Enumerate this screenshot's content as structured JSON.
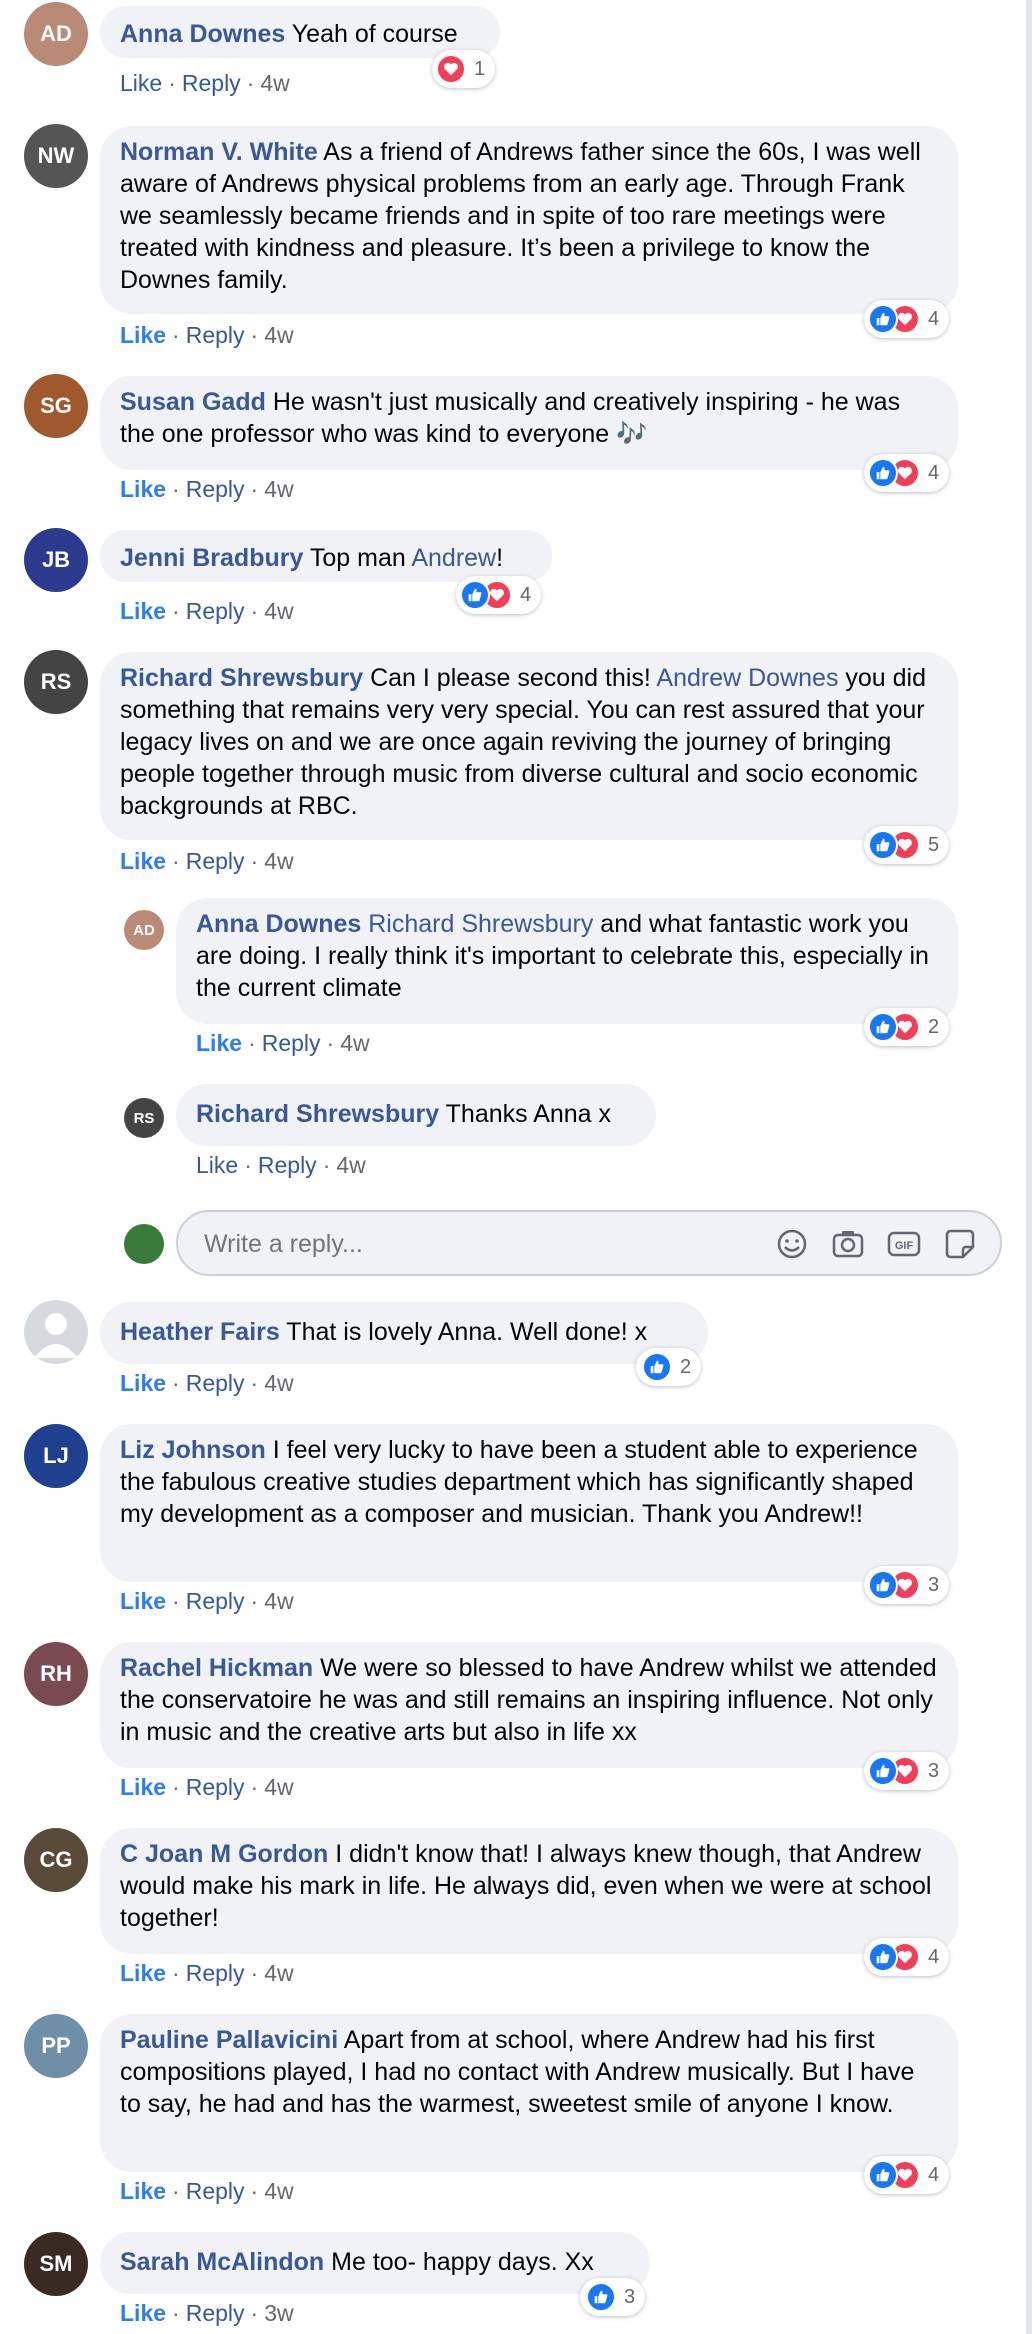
{
  "reactions": {
    "like_color": "#1877f2",
    "love_color": "#f33e58"
  },
  "comments": [
    {
      "author": "Anna Downes",
      "text": "Yeah of course",
      "like": "Like",
      "reply": "Reply",
      "time": "4w",
      "count": "1"
    },
    {
      "author": "Norman V. White",
      "text": "As a friend of Andrews father since the 60s, I was well aware of Andrews physical problems from an early age. Through Frank we seamlessly became friends and in spite of too rare meetings were treated with kindness and pleasure. It’s been a privilege to know the Downes family.",
      "like": "Like",
      "reply": "Reply",
      "time": "4w",
      "count": "4"
    },
    {
      "author": "Susan Gadd",
      "text": "He wasn't just musically and creatively inspiring - he was the one professor who was kind to everyone 🎶",
      "like": "Like",
      "reply": "Reply",
      "time": "4w",
      "count": "4"
    },
    {
      "author": "Jenni Bradbury",
      "text_before": "Top man",
      "mention": "Andrew",
      "text_after": "!",
      "like": "Like",
      "reply": "Reply",
      "time": "4w",
      "count": "4"
    },
    {
      "author": "Richard Shrewsbury",
      "text_before": "Can I please second this!",
      "mention": "Andrew Downes",
      "text_after": "you did something that remains very very special. You can rest assured that your legacy lives on and we are once again reviving the journey of bringing people together through music from diverse cultural and socio economic backgrounds at RBC.",
      "like": "Like",
      "reply": "Reply",
      "time": "4w",
      "count": "5"
    },
    {
      "author": "Anna Downes",
      "mention": "Richard Shrewsbury",
      "text_after": "and what fantastic work you are doing. I really think it's important to celebrate this, especially in the current climate",
      "like": "Like",
      "reply": "Reply",
      "time": "4w",
      "count": "2"
    },
    {
      "author": "Richard Shrewsbury",
      "text": "Thanks Anna x",
      "like": "Like",
      "reply": "Reply",
      "time": "4w"
    },
    {
      "author": "Heather Fairs",
      "text": "That is lovely Anna. Well done! x",
      "like": "Like",
      "reply": "Reply",
      "time": "4w",
      "count": "2"
    },
    {
      "author": "Liz Johnson",
      "text": "I feel very lucky to have been a student able to experience the fabulous creative studies department which has significantly shaped my development as a composer and musician. Thank you Andrew!!",
      "like": "Like",
      "reply": "Reply",
      "time": "4w",
      "count": "3"
    },
    {
      "author": "Rachel Hickman",
      "text": "We were so blessed to have Andrew whilst we attended the conservatoire he was and still remains an inspiring influence. Not only in music and the creative arts but also in life xx",
      "like": "Like",
      "reply": "Reply",
      "time": "4w",
      "count": "3"
    },
    {
      "author": "C Joan M Gordon",
      "text": "I didn't know that! I always knew though, that Andrew would make his mark in life. He always did, even when we were at school together!",
      "like": "Like",
      "reply": "Reply",
      "time": "4w",
      "count": "4"
    },
    {
      "author": "Pauline Pallavicini",
      "text": "Apart from at school, where Andrew had his first compositions played, I had no contact with Andrew musically. But I have to say, he had and has the warmest, sweetest smile of anyone I know.",
      "like": "Like",
      "reply": "Reply",
      "time": "4w",
      "count": "4"
    },
    {
      "author": "Sarah McAlindon",
      "text": "Me too- happy days. Xx",
      "like": "Like",
      "reply": "Reply",
      "time": "3w",
      "count": "3"
    }
  ],
  "reply_box": {
    "placeholder": "Write a reply...",
    "tools": [
      "emoji-icon",
      "camera-icon",
      "gif-icon",
      "sticker-icon"
    ]
  }
}
